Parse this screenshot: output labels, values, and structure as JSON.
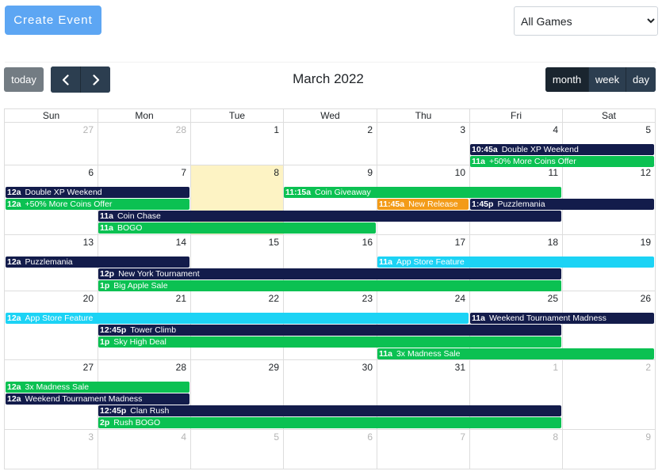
{
  "header": {
    "create_label": "Create Event",
    "game_select": {
      "selected": "All Games",
      "options": [
        "All Games"
      ]
    }
  },
  "toolbar": {
    "today_label": "today",
    "title": "March 2022",
    "views": [
      "month",
      "week",
      "day"
    ],
    "active_view": "month"
  },
  "calendar": {
    "dow": [
      "Sun",
      "Mon",
      "Tue",
      "Wed",
      "Thu",
      "Fri",
      "Sat"
    ],
    "weeks": [
      [
        {
          "d": "27",
          "o": true
        },
        {
          "d": "28",
          "o": true
        },
        {
          "d": "1"
        },
        {
          "d": "2"
        },
        {
          "d": "3"
        },
        {
          "d": "4"
        },
        {
          "d": "5"
        }
      ],
      [
        {
          "d": "6"
        },
        {
          "d": "7"
        },
        {
          "d": "8",
          "today": true
        },
        {
          "d": "9"
        },
        {
          "d": "10"
        },
        {
          "d": "11"
        },
        {
          "d": "12"
        }
      ],
      [
        {
          "d": "13"
        },
        {
          "d": "14"
        },
        {
          "d": "15"
        },
        {
          "d": "16"
        },
        {
          "d": "17"
        },
        {
          "d": "18"
        },
        {
          "d": "19"
        }
      ],
      [
        {
          "d": "20"
        },
        {
          "d": "21"
        },
        {
          "d": "22"
        },
        {
          "d": "23"
        },
        {
          "d": "24"
        },
        {
          "d": "25"
        },
        {
          "d": "26"
        }
      ],
      [
        {
          "d": "27"
        },
        {
          "d": "28"
        },
        {
          "d": "29"
        },
        {
          "d": "30"
        },
        {
          "d": "31"
        },
        {
          "d": "1",
          "o": true
        },
        {
          "d": "2",
          "o": true
        }
      ],
      [
        {
          "d": "3",
          "o": true
        },
        {
          "d": "4",
          "o": true
        },
        {
          "d": "5",
          "o": true
        },
        {
          "d": "6",
          "o": true
        },
        {
          "d": "7",
          "o": true
        },
        {
          "d": "8",
          "o": true
        },
        {
          "d": "9",
          "o": true
        }
      ]
    ],
    "colors": {
      "navy": "#131c4b",
      "green": "#0bc152",
      "orange": "#f39b18",
      "cyan": "#1cd3f5"
    },
    "events": [
      {
        "week": 0,
        "row": 0,
        "start": 5,
        "span": 2,
        "time": "10:45a",
        "title": "Double XP Weekend",
        "color": "navy"
      },
      {
        "week": 0,
        "row": 1,
        "start": 5,
        "span": 2,
        "time": "11a",
        "title": "+50% More Coins Offer",
        "color": "green"
      },
      {
        "week": 1,
        "row": 0,
        "start": 0,
        "span": 2,
        "time": "12a",
        "title": "Double XP Weekend",
        "color": "navy"
      },
      {
        "week": 1,
        "row": 0,
        "start": 3,
        "span": 3,
        "time": "11:15a",
        "title": "Coin Giveaway",
        "color": "green"
      },
      {
        "week": 1,
        "row": 1,
        "start": 0,
        "span": 2,
        "time": "12a",
        "title": "+50% More Coins Offer",
        "color": "green"
      },
      {
        "week": 1,
        "row": 1,
        "start": 4,
        "span": 1,
        "time": "11:45a",
        "title": "New Release",
        "color": "orange"
      },
      {
        "week": 1,
        "row": 1,
        "start": 5,
        "span": 2,
        "time": "1:45p",
        "title": "Puzzlemania",
        "color": "navy"
      },
      {
        "week": 1,
        "row": 2,
        "start": 1,
        "span": 5,
        "time": "11a",
        "title": "Coin Chase",
        "color": "navy"
      },
      {
        "week": 1,
        "row": 3,
        "start": 1,
        "span": 3,
        "time": "11a",
        "title": "BOGO",
        "color": "green"
      },
      {
        "week": 2,
        "row": 0,
        "start": 0,
        "span": 2,
        "time": "12a",
        "title": "Puzzlemania",
        "color": "navy"
      },
      {
        "week": 2,
        "row": 0,
        "start": 4,
        "span": 3,
        "time": "11a",
        "title": "App Store Feature",
        "color": "cyan"
      },
      {
        "week": 2,
        "row": 1,
        "start": 1,
        "span": 5,
        "time": "12p",
        "title": "New York Tournament",
        "color": "navy"
      },
      {
        "week": 2,
        "row": 2,
        "start": 1,
        "span": 5,
        "time": "1p",
        "title": "Big Apple Sale",
        "color": "green"
      },
      {
        "week": 3,
        "row": 0,
        "start": 0,
        "span": 5,
        "time": "12a",
        "title": "App Store Feature",
        "color": "cyan"
      },
      {
        "week": 3,
        "row": 0,
        "start": 5,
        "span": 2,
        "time": "11a",
        "title": "Weekend Tournament Madness",
        "color": "navy"
      },
      {
        "week": 3,
        "row": 1,
        "start": 1,
        "span": 5,
        "time": "12:45p",
        "title": "Tower Climb",
        "color": "navy"
      },
      {
        "week": 3,
        "row": 2,
        "start": 1,
        "span": 5,
        "time": "1p",
        "title": "Sky High Deal",
        "color": "green"
      },
      {
        "week": 3,
        "row": 3,
        "start": 4,
        "span": 3,
        "time": "11a",
        "title": "3x Madness Sale",
        "color": "green"
      },
      {
        "week": 4,
        "row": 0,
        "start": 0,
        "span": 2,
        "time": "12a",
        "title": "3x Madness Sale",
        "color": "green"
      },
      {
        "week": 4,
        "row": 1,
        "start": 0,
        "span": 2,
        "time": "12a",
        "title": "Weekend Tournament Madness",
        "color": "navy"
      },
      {
        "week": 4,
        "row": 2,
        "start": 1,
        "span": 5,
        "time": "12:45p",
        "title": "Clan Rush",
        "color": "navy"
      },
      {
        "week": 4,
        "row": 3,
        "start": 1,
        "span": 5,
        "time": "2p",
        "title": "Rush BOGO",
        "color": "green"
      }
    ]
  }
}
